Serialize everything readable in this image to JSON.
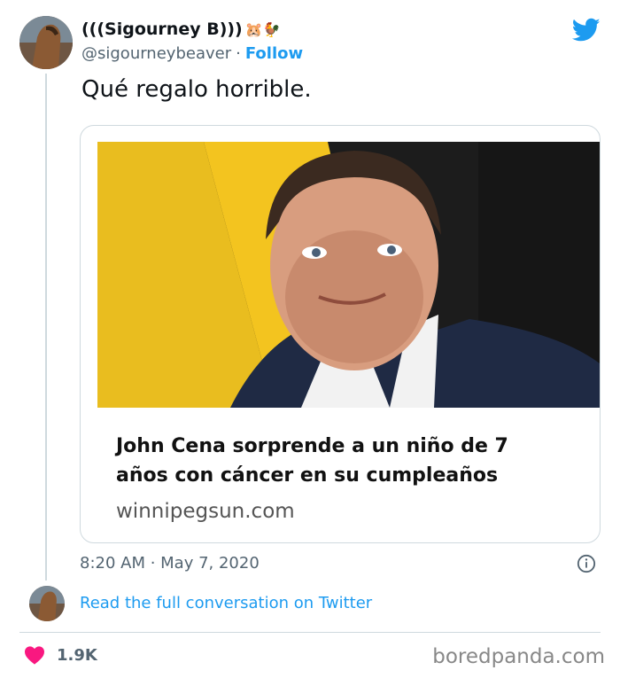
{
  "tweet": {
    "display_name": "(((Sigourney B)))",
    "name_emoji": "🐹🐓",
    "handle": "@sigourneybeaver",
    "separator": "·",
    "follow_label": "Follow",
    "text": "Qué regalo horrible.",
    "timestamp": "8:20 AM · May 7, 2020",
    "likes": "1.9K"
  },
  "card": {
    "title": "John Cena sorprende a un niño de 7 años con cáncer en su cumpleaños",
    "domain": "winnipegsun.com"
  },
  "footer": {
    "read_conversation": "Read the full conversation on Twitter",
    "watermark": "boredpanda.com"
  },
  "icons": {
    "brand": "twitter-bird-icon",
    "info": "info-icon",
    "like": "heart-icon"
  },
  "colors": {
    "accent": "#1d9bf0",
    "like": "#f91880",
    "muted": "#536471"
  }
}
